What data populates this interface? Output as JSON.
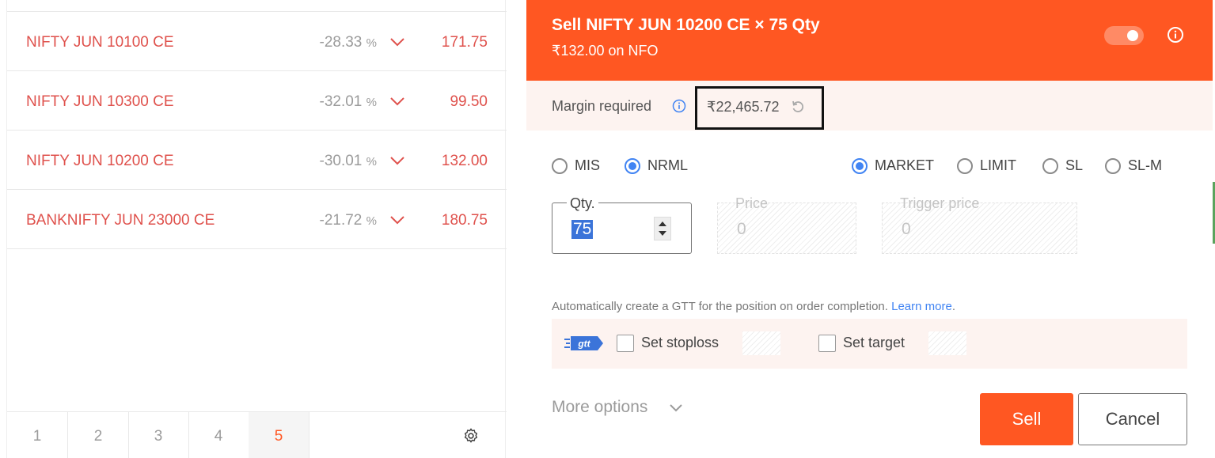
{
  "watchlist": {
    "items": [
      {
        "symbol": "NIFTY JUN 10100 CE",
        "change": "-28.33",
        "unit": "%",
        "price": "171.75"
      },
      {
        "symbol": "NIFTY JUN 10300 CE",
        "change": "-32.01",
        "unit": "%",
        "price": "99.50"
      },
      {
        "symbol": "NIFTY JUN 10200 CE",
        "change": "-30.01",
        "unit": "%",
        "price": "132.00"
      },
      {
        "symbol": "BANKNIFTY JUN 23000 CE",
        "change": "-21.72",
        "unit": "%",
        "price": "180.75"
      }
    ],
    "pages": [
      "1",
      "2",
      "3",
      "4",
      "5"
    ],
    "active_page": "5"
  },
  "order": {
    "title": "Sell NIFTY JUN 10200 CE × 75 Qty",
    "subtitle": "₹132.00 on NFO",
    "margin_label": "Margin required",
    "margin_value": "₹22,465.72",
    "products": [
      {
        "label": "MIS",
        "checked": false
      },
      {
        "label": "NRML",
        "checked": true
      }
    ],
    "order_types": [
      {
        "label": "MARKET",
        "checked": true
      },
      {
        "label": "LIMIT",
        "checked": false
      },
      {
        "label": "SL",
        "checked": false
      },
      {
        "label": "SL-M",
        "checked": false
      }
    ],
    "qty_label": "Qty.",
    "qty_value": "75",
    "price_label": "Price",
    "price_value": "0",
    "trigger_label": "Trigger price",
    "trigger_value": "0",
    "gtt_note": "Automatically create a GTT for the position on order completion.",
    "gtt_link": "Learn more",
    "gtt_logo": "gtt",
    "stoploss_label": "Set stoploss",
    "target_label": "Set target",
    "more_options": "More options",
    "sell_label": "Sell",
    "cancel_label": "Cancel"
  },
  "colors": {
    "brand": "#ff5722",
    "loss_red": "#df514c",
    "link_blue": "#4184f3"
  }
}
